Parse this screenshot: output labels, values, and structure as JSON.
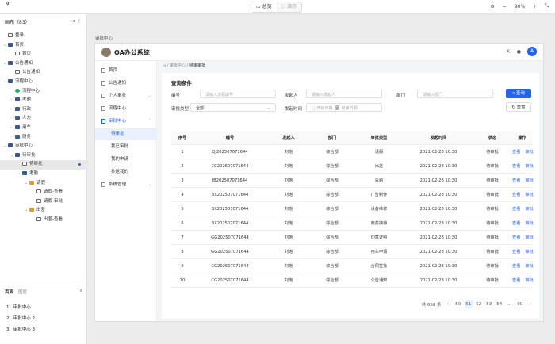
{
  "topbar": {
    "logo": "ᴴᶦ",
    "tab_active": "总览",
    "tab_inactive": "演示",
    "zoom": "90%"
  },
  "layers": {
    "header": "画布（83）",
    "tree": [
      {
        "label": "登录",
        "level": 1,
        "arrow": "",
        "icon": "fr"
      },
      {
        "label": "首页",
        "level": 1,
        "arrow": "v",
        "icon": "fb"
      },
      {
        "label": "首页",
        "level": 2,
        "arrow": "",
        "icon": "fr"
      },
      {
        "label": "公告通知",
        "level": 1,
        "arrow": "v",
        "icon": "fb"
      },
      {
        "label": "公告通知",
        "level": 2,
        "arrow": "",
        "icon": "fr"
      },
      {
        "label": "流程中心",
        "level": 1,
        "arrow": "v",
        "icon": "fb"
      },
      {
        "label": "流程中心",
        "level": 2,
        "arrow": "",
        "icon": "fg"
      },
      {
        "label": "考勤",
        "level": 2,
        "arrow": ">",
        "icon": "fb"
      },
      {
        "label": "行政",
        "level": 2,
        "arrow": ">",
        "icon": "fb"
      },
      {
        "label": "人力",
        "level": 2,
        "arrow": ">",
        "icon": "fb"
      },
      {
        "label": "用车",
        "level": 2,
        "arrow": ">",
        "icon": "fb"
      },
      {
        "label": "财务",
        "level": 2,
        "arrow": ">",
        "icon": "fb"
      },
      {
        "label": "审批中心",
        "level": 1,
        "arrow": "v",
        "icon": "fb"
      },
      {
        "label": "待审批",
        "level": 2,
        "arrow": "v",
        "icon": "fb"
      },
      {
        "label": "待审批",
        "level": 3,
        "arrow": "",
        "icon": "fr",
        "selected": true
      },
      {
        "label": "考勤",
        "level": 3,
        "arrow": "v",
        "icon": "fb"
      },
      {
        "label": "请假",
        "level": 4,
        "arrow": "v",
        "icon": "fy"
      },
      {
        "label": "请假-查看",
        "level": 5,
        "arrow": "",
        "icon": "fr"
      },
      {
        "label": "请假-审批",
        "level": 5,
        "arrow": "",
        "icon": "fr"
      },
      {
        "label": "出差",
        "level": 4,
        "arrow": "v",
        "icon": "fy"
      },
      {
        "label": "出差-查看",
        "level": 5,
        "arrow": "",
        "icon": "fr"
      }
    ]
  },
  "pages": {
    "header": "页面",
    "tab2": "图层",
    "items": [
      {
        "n": "1",
        "label": "审批中心"
      },
      {
        "n": "2",
        "label": "审批中心 2"
      },
      {
        "n": "3",
        "label": "审批中心 3"
      }
    ]
  },
  "canvas_label": "审批中心",
  "app": {
    "title": "OA办公系统",
    "avatar": "A",
    "menu": [
      {
        "label": "首页",
        "type": "top"
      },
      {
        "label": "公告通知",
        "type": "top"
      },
      {
        "label": "个人事务",
        "type": "top",
        "chev": "v"
      },
      {
        "label": "流程中心",
        "type": "top"
      },
      {
        "label": "审批中心",
        "type": "active",
        "chev": "^"
      },
      {
        "label": "待审批",
        "type": "subact"
      },
      {
        "label": "我已审批",
        "type": "sub"
      },
      {
        "label": "我的申请",
        "type": "sub"
      },
      {
        "label": "抄送我的",
        "type": "sub"
      },
      {
        "label": "系统管理",
        "type": "top",
        "chev": "v"
      }
    ],
    "breadcrumb": {
      "parent": "审批中心",
      "current": "待审审批"
    },
    "query": {
      "title": "查询条件",
      "no_label": "编号",
      "no_ph": "请输入流程编号",
      "initiator_label": "发起人",
      "initiator_ph": "请输入发起人",
      "dept_label": "部门",
      "dept_ph": "请输入部门",
      "type_label": "审批类型",
      "type_value": "全部",
      "time_label": "发起时间",
      "start_ph": "开始日期",
      "sep": "至",
      "end_ph": "结束日期",
      "search": "查询",
      "reset": "重置"
    },
    "table": {
      "headers": [
        "序号",
        "编号",
        "发起人",
        "部门",
        "审批类型",
        "发起时间",
        "状态",
        "操作"
      ],
      "rows": [
        [
          "1",
          "QJ202507071644",
          "刘饱",
          "综合部",
          "请假",
          "2021-02-28  10:30",
          "待审批"
        ],
        [
          "2",
          "CC202507071644",
          "刘饱",
          "综合部",
          "出差",
          "2021-02-28  10:30",
          "待审批"
        ],
        [
          "3",
          "JB202507071644",
          "刘饱",
          "综合部",
          "采购",
          "2021-02-28  10:30",
          "待审批"
        ],
        [
          "4",
          "BX202507071644",
          "刘饱",
          "综合部",
          "广告制作",
          "2021-02-28  10:30",
          "待审批"
        ],
        [
          "5",
          "BX202507071644",
          "刘饱",
          "综合部",
          "设备维修",
          "2021-02-28  10:30",
          "待审批"
        ],
        [
          "6",
          "BX202507071644",
          "刘饱",
          "综合部",
          "商务接待",
          "2021-02-28  10:30",
          "待审批"
        ],
        [
          "7",
          "GG202507071644",
          "刘饱",
          "综合部",
          "印章证照",
          "2021-02-28  10:30",
          "待审批"
        ],
        [
          "8",
          "GG202507071644",
          "刘饱",
          "综合部",
          "用车申请",
          "2021-02-28  10:30",
          "待审批"
        ],
        [
          "9",
          "CG202507071644",
          "刘饱",
          "综合部",
          "合同签批",
          "2021-02-28  10:30",
          "待审批"
        ],
        [
          "10",
          "CG202507071644",
          "刘饱",
          "综合部",
          "公告通知",
          "2021-02-28  10:30",
          "待审批"
        ]
      ],
      "view": "查看",
      "approve": "审批"
    },
    "pager": {
      "total": "共 658 条",
      "pages": [
        "50",
        "51",
        "52",
        "53",
        "54",
        "...",
        "90"
      ],
      "current": "51"
    }
  }
}
